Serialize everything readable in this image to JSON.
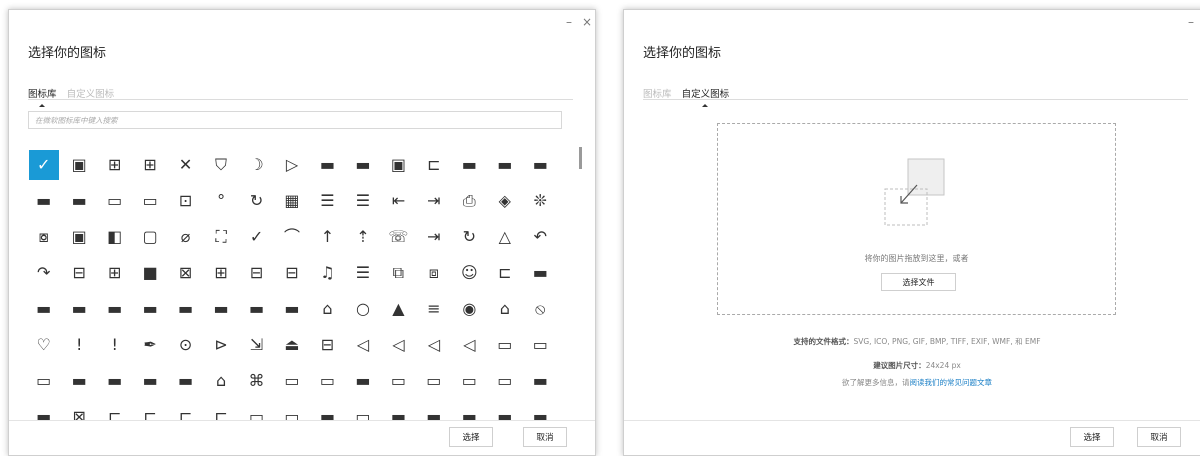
{
  "left_dialog": {
    "title": "选择你的图标",
    "minimize": "–",
    "close": "×",
    "tabs": [
      {
        "label": "图标库",
        "active": true
      },
      {
        "label": "自定义图标",
        "active": false
      }
    ],
    "search_placeholder": "在微软图标库中键入搜索",
    "icons": [
      "✓",
      "▣",
      "⊞",
      "⊞",
      "✕",
      "⛉",
      "☽",
      "▷",
      "▬",
      "▬",
      "▣",
      "⊏",
      "▬",
      "▬",
      "▬",
      "▬",
      "▬",
      "▭",
      "▭",
      "⊡",
      "°",
      "↻",
      "▦",
      "☰",
      "☰",
      "⇤",
      "⇥",
      "⎙",
      "◈",
      "❊",
      "⧇",
      "▣",
      "◧",
      "▢",
      "⌀",
      "⛶",
      "✓",
      "⌒",
      "↑",
      "⇡",
      "☏",
      "⇥",
      "↻",
      "△",
      "↶",
      "↷",
      "⊟",
      "⊞",
      "■",
      "⊠",
      "⊞",
      "⊟",
      "⊟",
      "♫",
      "☰",
      "⧉",
      "⧈",
      "☺",
      "⊏",
      "▬",
      "▬",
      "▬",
      "▬",
      "▬",
      "▬",
      "▬",
      "▬",
      "▬",
      "⌂",
      "○",
      "▲",
      "≡",
      "◉",
      "⌂",
      "⦸",
      "♡",
      "!",
      "!",
      "✒",
      "⊙",
      "⊳",
      "⇲",
      "⏏",
      "⊟",
      "◁",
      "◁",
      "◁",
      "◁",
      "▭",
      "▭",
      "▭",
      "▬",
      "▬",
      "▬",
      "▬",
      "⌂",
      "⌘",
      "▭",
      "▭",
      "▬",
      "▭",
      "▭",
      "▭",
      "▭",
      "▬",
      "▬",
      "⊠",
      "⊏",
      "⊏",
      "⊏",
      "⊏",
      "▭",
      "▭",
      "▬",
      "▭",
      "▬",
      "▬",
      "▬",
      "▬",
      "▬",
      "▬",
      "▬",
      "▬",
      "▭",
      "▬",
      "▭",
      "▭",
      "▭",
      "▭",
      "▭",
      "▭",
      "▭",
      "▭",
      "▭",
      "▭"
    ],
    "ok": "选择",
    "cancel": "取消"
  },
  "right_dialog": {
    "title": "选择你的图标",
    "minimize": "–",
    "close": "×",
    "tabs": [
      {
        "label": "图标库",
        "active": false
      },
      {
        "label": "自定义图标",
        "active": true
      }
    ],
    "drop_text": "将你的图片拖放到这里，或者",
    "choose_file": "选择文件",
    "formats_label": "支持的文件格式：",
    "formats_value": "SVG, ICO, PNG, GIF, BMP, TIFF, EXIF, WMF, 和 EMF",
    "size_label": "建议图片尺寸：",
    "size_value": "24x24 px",
    "more_prefix": "欲了解更多信息，请",
    "more_link": "阅读我们的常见问题文章",
    "ok": "选择",
    "cancel": "取消"
  }
}
